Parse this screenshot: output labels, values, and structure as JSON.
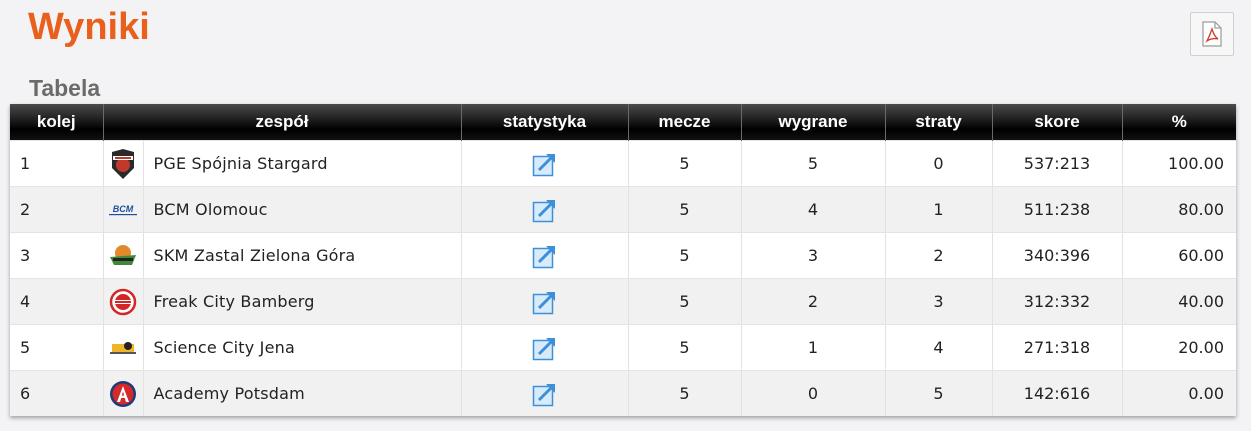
{
  "page": {
    "title": "Wyniki",
    "section_title": "Tabela"
  },
  "toolbar": {
    "pdf_icon": "pdf-icon"
  },
  "colors": {
    "title": "#e8601c",
    "stat_icon": "#3d8fd8",
    "header_bg": "#000000"
  },
  "table": {
    "columns": [
      "kolej",
      "zespół",
      "statystyka",
      "mecze",
      "wygrane",
      "straty",
      "skore",
      "%"
    ],
    "rows": [
      {
        "rank": "1",
        "team": "PGE Spójnia Stargard",
        "games": "5",
        "wins": "5",
        "losses": "0",
        "score": "537:213",
        "pct": "100.00"
      },
      {
        "rank": "2",
        "team": "BCM Olomouc",
        "games": "5",
        "wins": "4",
        "losses": "1",
        "score": "511:238",
        "pct": "80.00"
      },
      {
        "rank": "3",
        "team": "SKM Zastal Zielona Góra",
        "games": "5",
        "wins": "3",
        "losses": "2",
        "score": "340:396",
        "pct": "60.00"
      },
      {
        "rank": "4",
        "team": "Freak City Bamberg",
        "games": "5",
        "wins": "2",
        "losses": "3",
        "score": "312:332",
        "pct": "40.00"
      },
      {
        "rank": "5",
        "team": "Science City Jena",
        "games": "5",
        "wins": "1",
        "losses": "4",
        "score": "271:318",
        "pct": "20.00"
      },
      {
        "rank": "6",
        "team": "Academy Potsdam",
        "games": "5",
        "wins": "0",
        "losses": "5",
        "score": "142:616",
        "pct": "0.00"
      }
    ]
  }
}
